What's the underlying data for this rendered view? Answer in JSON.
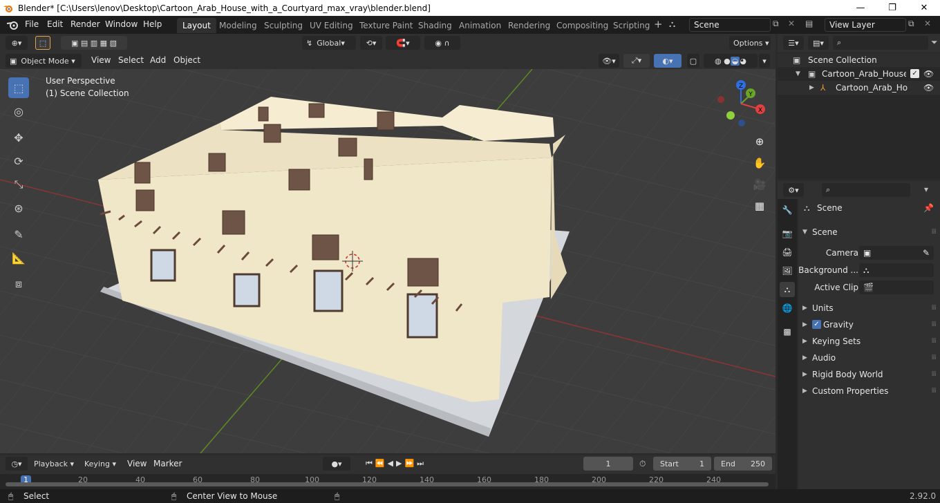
{
  "window": {
    "title": "Blender* [C:\\Users\\lenov\\Desktop\\Cartoon_Arab_House_with_a_Courtyard_max_vray\\blender.blend]",
    "minimize": "—",
    "maximize": "❐",
    "close": "✕"
  },
  "menu": [
    "File",
    "Edit",
    "Render",
    "Window",
    "Help"
  ],
  "workspaces": [
    "Layout",
    "Modeling",
    "Sculpting",
    "UV Editing",
    "Texture Paint",
    "Shading",
    "Animation",
    "Rendering",
    "Compositing",
    "Scripting"
  ],
  "active_workspace": "Layout",
  "scene_field": "Scene",
  "view_layer_field": "View Layer",
  "toolbar": {
    "orientation": "Global",
    "options": "Options"
  },
  "viewport_header": {
    "mode": "Object Mode",
    "menus": [
      "View",
      "Select",
      "Add",
      "Object"
    ]
  },
  "viewport": {
    "perspective": "User Perspective",
    "collection": "(1) Scene Collection",
    "gizmo": {
      "x": "X",
      "y": "Y",
      "z": "Z"
    }
  },
  "outliner": {
    "root": "Scene Collection",
    "items": [
      "Cartoon_Arab_House_wit",
      "Cartoon_Arab_House"
    ]
  },
  "properties": {
    "context": "Scene",
    "panel_title": "Scene",
    "fields": [
      {
        "label": "Camera"
      },
      {
        "label": "Background ..."
      },
      {
        "label": "Active Clip"
      }
    ],
    "panels": [
      "Units",
      "Gravity",
      "Keying Sets",
      "Audio",
      "Rigid Body World",
      "Custom Properties"
    ],
    "gravity_checked": true
  },
  "timeline": {
    "menus": [
      "Playback",
      "Keying",
      "View",
      "Marker"
    ],
    "current_frame": "1",
    "start_label": "Start",
    "start": "1",
    "end_label": "End",
    "end": "250",
    "ruler": [
      "1",
      "20",
      "40",
      "60",
      "80",
      "100",
      "120",
      "140",
      "160",
      "180",
      "200",
      "220",
      "240"
    ]
  },
  "statusbar": {
    "left": "Select",
    "middle": "Center View to Mouse",
    "version": "2.92.0"
  },
  "colors": {
    "accent": "#4772b3",
    "wall": "#f1e7c9",
    "ground": "#d4d7dc",
    "x_axis": "#8a3535",
    "y_axis": "#5f8a22"
  }
}
